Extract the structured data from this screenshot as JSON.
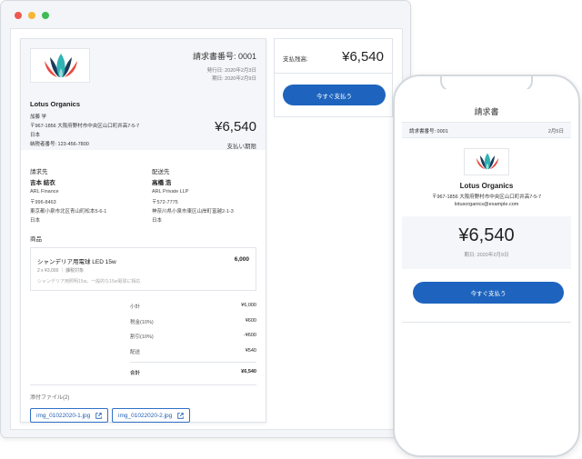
{
  "invoice": {
    "number_label": "請求書番号: 0001",
    "issue_date": "発行日: 2020年2月3日",
    "due_date": "期日: 2020年2月9日",
    "company": "Lotus Organics",
    "contact": "加藤 学",
    "address": "〒967-1856 大阪府野村市中央区山口町井高7-5-7",
    "country": "日本",
    "tax_number": "納税者番号: 123-456-7800",
    "amount": "¥6,540",
    "due_label": "支払い期限",
    "bill_to": {
      "title": "請求先",
      "name": "吉本 結衣",
      "lines": [
        "ARL Finance",
        "〒996-8463",
        "東京都小泉市北区青山町松本5-6-1",
        "日本"
      ]
    },
    "ship_to": {
      "title": "配送先",
      "name": "高橋 浩",
      "lines": [
        "ARL Private LLP",
        "〒572-7775",
        "神奈川県小泉市東区山岸町富越2-1-3",
        "日本"
      ]
    },
    "items_title": "商品",
    "item": {
      "name": "シャンデリア用電球 LED 15w",
      "price": "6,000",
      "qty": "2 x ¥3,000 ｜ 課税対象",
      "note": "シャンデリア用照明15w。一般的な15w電球に相応"
    },
    "totals": [
      {
        "label": "小計",
        "value": "¥6,000"
      },
      {
        "label": "税金(10%)",
        "value": "¥600"
      },
      {
        "label": "割引(10%)",
        "value": "-¥600"
      },
      {
        "label": "配送",
        "value": "¥540"
      }
    ],
    "total": {
      "label": "合計",
      "value": "¥6,540"
    },
    "attachments_label": "添付ファイル(2)",
    "attachments": [
      "img_01022020-1.jpg",
      "img_01022020-2.jpg"
    ]
  },
  "balance": {
    "label": "支払残高:",
    "amount": "¥6,540",
    "pay_button": "今すぐ支払う"
  },
  "mobile": {
    "title": "請求書",
    "invoice_number": "請求書番号: 0001",
    "date": "2月5日",
    "company": "Lotus Organics",
    "address": "〒967-1856 大阪府野村市中央区山口町井高7-5-7",
    "email": "lotusorganics@example.com",
    "amount": "¥6,540",
    "due": "期日: 2020年2月9日",
    "pay_button": "今すぐ支払う"
  },
  "colors": {
    "primary": "#1e64be",
    "lotus_teal": "#2fb3b4",
    "lotus_red": "#e8483f",
    "lotus_navy": "#1c3b5a"
  }
}
